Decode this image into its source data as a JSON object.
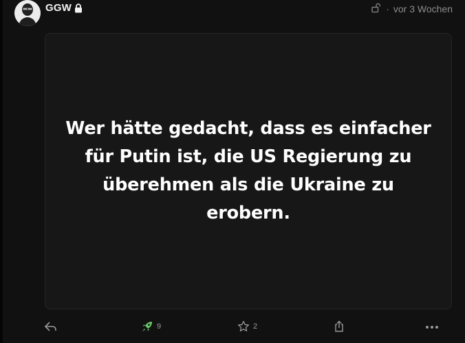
{
  "post": {
    "author_name": "GGW",
    "timestamp": "vor 3 Wochen",
    "separator": "·",
    "text": "Wer hätte gedacht, dass es einfacher für Putin ist, die US Regierung zu überehmen als die Ukraine zu erobern."
  },
  "actions": {
    "boost_count": "9",
    "favourite_count": "2"
  },
  "icons": {
    "lock": "lock-icon",
    "visibility": "unlock-icon",
    "reply": "reply-icon",
    "boost": "rocket-icon",
    "favourite": "star-icon",
    "share": "share-icon",
    "more": "more-icon"
  },
  "colors": {
    "background": "#111111",
    "card": "#171717",
    "text": "#ffffff",
    "muted": "#8c8c8c",
    "boost_active": "#6bc46b"
  }
}
